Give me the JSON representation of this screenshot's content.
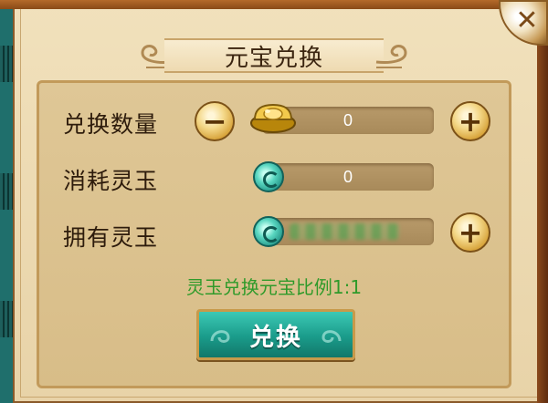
{
  "dialog": {
    "title": "元宝兑换",
    "close_icon": "✕"
  },
  "rows": [
    {
      "label": "兑换数量",
      "value": "0",
      "minus_icon": "−",
      "plus_icon": "+",
      "currency_icon": "gold-ingot-icon"
    },
    {
      "label": "消耗灵玉",
      "value": "0",
      "currency_icon": "jade-icon"
    },
    {
      "label": "拥有灵玉",
      "value": "",
      "plus_icon": "+",
      "currency_icon": "jade-icon"
    }
  ],
  "ratio_text": "灵玉兑换元宝比例1:1",
  "action": {
    "label": "兑换"
  },
  "colors": {
    "accent_teal": "#1a9b8a",
    "ratio_green": "#2f9a2a",
    "gold": "#d7a33a"
  }
}
